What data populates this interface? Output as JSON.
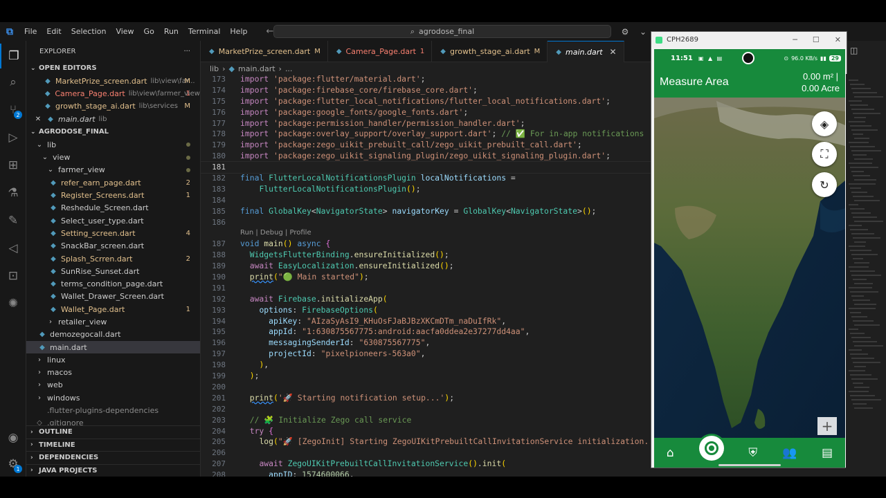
{
  "menu": [
    "File",
    "Edit",
    "Selection",
    "View",
    "Go",
    "Run",
    "Terminal",
    "Help"
  ],
  "search": {
    "text": "agrodose_final"
  },
  "explorer": {
    "title": "EXPLORER",
    "more": "···",
    "open_editors_label": "OPEN EDITORS",
    "open_editors": [
      {
        "name": "MarketPrize_screen.dart",
        "path": "lib\\view\\far...",
        "status": "M"
      },
      {
        "name": "Camera_Page.dart",
        "path": "lib\\view\\farmer_view",
        "status": "1"
      },
      {
        "name": "growth_stage_ai.dart",
        "path": "lib\\services",
        "status": "M"
      },
      {
        "name": "main.dart",
        "path": "lib",
        "status": ""
      }
    ],
    "project_label": "AGRODOSE_FINAL",
    "lib": "lib",
    "view": "view",
    "farmer_view": "farmer_view",
    "farmer_files": [
      {
        "name": "refer_earn_page.dart",
        "status": "2"
      },
      {
        "name": "Register_Screens.dart",
        "status": "1"
      },
      {
        "name": "Reshedule_Screen.dart",
        "status": ""
      },
      {
        "name": "Select_user_type.dart",
        "status": ""
      },
      {
        "name": "Setting_screen.dart",
        "status": "4"
      },
      {
        "name": "SnackBar_screen.dart",
        "status": ""
      },
      {
        "name": "Splash_Scrren.dart",
        "status": "2"
      },
      {
        "name": "SunRise_Sunset.dart",
        "status": ""
      },
      {
        "name": "terms_condition_page.dart",
        "status": ""
      },
      {
        "name": "Wallet_Drawer_Screen.dart",
        "status": ""
      },
      {
        "name": "Wallet_Page.dart",
        "status": "1"
      }
    ],
    "retailer_view": "retailer_view",
    "lib_files": [
      "demozegocall.dart",
      "main.dart"
    ],
    "root_folders": [
      "linux",
      "macos",
      "web",
      "windows"
    ],
    "root_files": [
      ".flutter-plugins-dependencies",
      ".gitignore"
    ],
    "bottom_sections": [
      "OUTLINE",
      "TIMELINE",
      "DEPENDENCIES",
      "JAVA PROJECTS"
    ]
  },
  "tabs": [
    {
      "name": "MarketPrize_screen.dart",
      "status": "M"
    },
    {
      "name": "Camera_Page.dart",
      "status": "1"
    },
    {
      "name": "growth_stage_ai.dart",
      "status": "M"
    },
    {
      "name": "main.dart",
      "status": ""
    }
  ],
  "breadcrumb": {
    "folder": "lib",
    "sep": "›",
    "file": "main.dart",
    "tail": "..."
  },
  "codelens": "Run | Debug | Profile",
  "code": [
    {
      "n": "173",
      "t": "import 'package:flutter/material.dart';"
    },
    {
      "n": "174",
      "t": "import 'package:firebase_core/firebase_core.dart';"
    },
    {
      "n": "175",
      "t": "import 'package:flutter_local_notifications/flutter_local_notifications.dart';"
    },
    {
      "n": "176",
      "t": "import 'package:google_fonts/google_fonts.dart';"
    },
    {
      "n": "177",
      "t": "import 'package:permission_handler/permission_handler.dart';"
    },
    {
      "n": "178",
      "t": "import 'package:overlay_support/overlay_support.dart'; // ✅ For in-app notifications"
    },
    {
      "n": "179",
      "t": "import 'package:zego_uikit_prebuilt_call/zego_uikit_prebuilt_call.dart';"
    },
    {
      "n": "180",
      "t": "import 'package:zego_uikit_signaling_plugin/zego_uikit_signaling_plugin.dart';"
    },
    {
      "n": "181",
      "t": ""
    },
    {
      "n": "182",
      "t": "final FlutterLocalNotificationsPlugin localNotifications ="
    },
    {
      "n": "183",
      "t": "    FlutterLocalNotificationsPlugin();"
    },
    {
      "n": "184",
      "t": ""
    },
    {
      "n": "185",
      "t": "final GlobalKey<NavigatorState> navigatorKey = GlobalKey<NavigatorState>();"
    },
    {
      "n": "186",
      "t": ""
    },
    {
      "n": "187",
      "t": "void main() async {"
    },
    {
      "n": "188",
      "t": "  WidgetsFlutterBinding.ensureInitialized();"
    },
    {
      "n": "189",
      "t": "  await EasyLocalization.ensureInitialized();"
    },
    {
      "n": "190",
      "t": "  print(\"🟢 Main started\");"
    },
    {
      "n": "191",
      "t": ""
    },
    {
      "n": "192",
      "t": "  await Firebase.initializeApp("
    },
    {
      "n": "193",
      "t": "    options: FirebaseOptions("
    },
    {
      "n": "194",
      "t": "      apiKey: \"AIzaSyAsI9_KHuOsFJaBJBzXKCmDTm_naDuIfRk\","
    },
    {
      "n": "195",
      "t": "      appId: \"1:630875567775:android:aacfa0ddea2e37277dd4aa\","
    },
    {
      "n": "196",
      "t": "      messagingSenderId: \"630875567775\","
    },
    {
      "n": "197",
      "t": "      projectId: \"pixelpioneers-563a0\","
    },
    {
      "n": "198",
      "t": "    ),"
    },
    {
      "n": "199",
      "t": "  );"
    },
    {
      "n": "200",
      "t": ""
    },
    {
      "n": "201",
      "t": "  print('🚀 Starting notification setup...');"
    },
    {
      "n": "202",
      "t": ""
    },
    {
      "n": "203",
      "t": "  // 🧩 Initialize Zego call service"
    },
    {
      "n": "204",
      "t": "  try {"
    },
    {
      "n": "205",
      "t": "    log(\"🚀 [ZegoInit] Starting ZegoUIKitPrebuiltCallInvitationService initialization...\");"
    },
    {
      "n": "206",
      "t": ""
    },
    {
      "n": "207",
      "t": "    await ZegoUIKitPrebuiltCallInvitationService().init("
    },
    {
      "n": "208",
      "t": "      appID: 1574600066,"
    }
  ],
  "emulator": {
    "window_title": "CPH2689",
    "status_time": "11:51",
    "status_right": "96.0 KB/s",
    "battery": "29",
    "app_title": "Measure Area",
    "area_line1": "0.00 m² |",
    "area_line2": "0.00 Acre",
    "zoom_plus": "+"
  },
  "colors": {
    "accent": "#0078d4",
    "app_green": "#178a3c"
  }
}
